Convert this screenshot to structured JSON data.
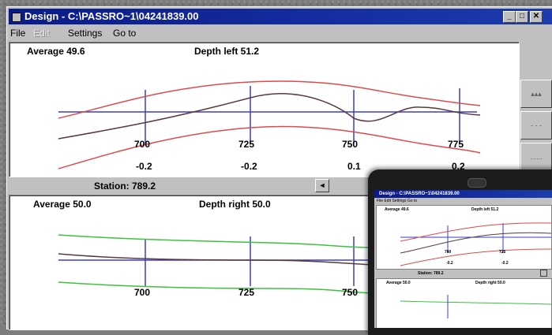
{
  "window": {
    "title": "Design - C:\\PASSRO~1\\04241839.00",
    "minimize": "_",
    "maximize": "□",
    "close": "✕"
  },
  "menu": {
    "file": "File",
    "edit": "Edit",
    "settings": "Settings",
    "goto": "Go to"
  },
  "top_panel": {
    "average": "Average 49.6",
    "depth": "Depth left 51.2",
    "ticks": [
      "700",
      "725",
      "750",
      "775"
    ],
    "offsets": [
      "-0.2",
      "-0.2",
      "0.1",
      "0.2"
    ]
  },
  "station": "Station: 789.2",
  "scroll_left": "◄",
  "bottom_panel": {
    "average": "Average 50.0",
    "depth": "Depth right 50.0",
    "ticks": [
      "700",
      "725",
      "750"
    ]
  },
  "colors": {
    "title_bar": "#0a1a8a",
    "left_limit": "#e04a4a",
    "right_limit": "#3cc23c",
    "profile": "#5a3a3a",
    "axis": "#3a3ad8"
  },
  "mini": {
    "title": "Design - C:\\PASSRO~1\\04241839.00",
    "menu": "File   Edit   Settings   Go to",
    "average_top": "Average 49.6",
    "depth_top": "Depth left 51.2",
    "tick_700": "700",
    "tick_725": "725",
    "off_1": "-0.2",
    "off_2": "-0.2",
    "station": "Station: 789.2",
    "average_bottom": "Average 50.0",
    "depth_bottom": "Depth right 50.0"
  },
  "icons": [
    "window-icon",
    "minimize-icon",
    "maximize-icon",
    "close-icon",
    "scroll-left-icon",
    "zoom-icon"
  ]
}
